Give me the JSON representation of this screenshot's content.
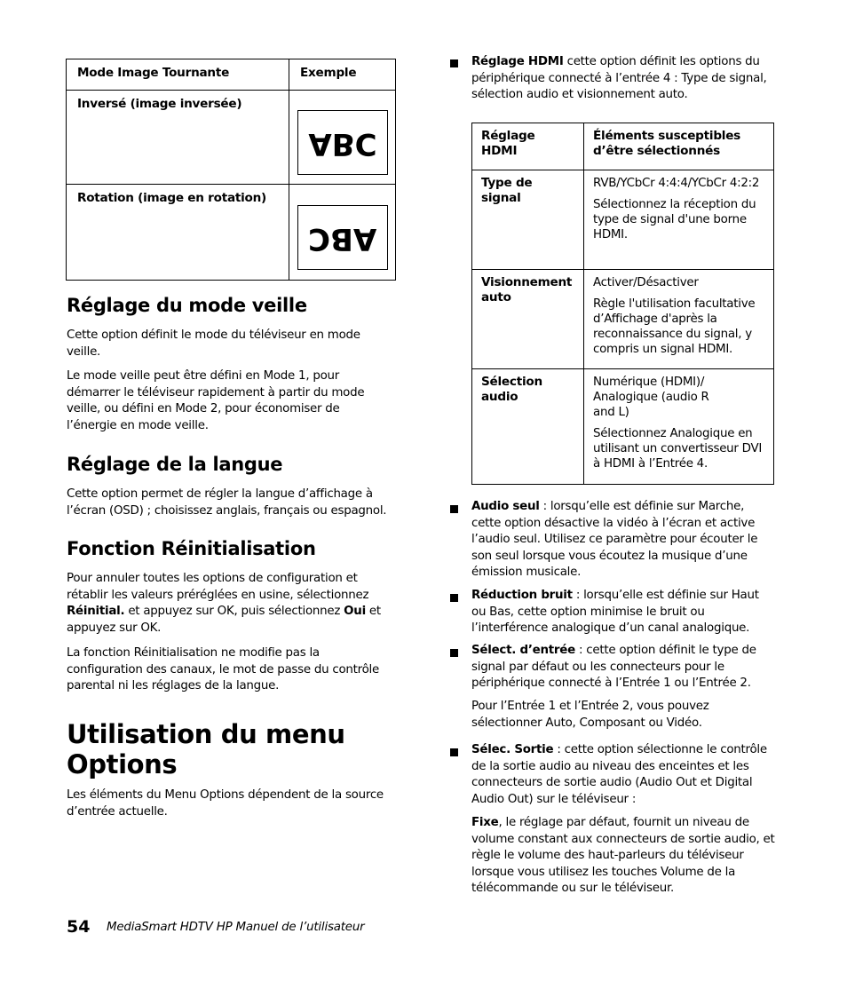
{
  "rotate_table": {
    "headers": [
      "Mode Image Tournante",
      "Exemple"
    ],
    "rows": [
      {
        "label": "Inversé (image inversée)",
        "example": "ABC",
        "example_transform": "vertical-flip"
      },
      {
        "label": "Rotation (image en rotation)",
        "example": "ABC",
        "example_transform": "rotate-180"
      }
    ]
  },
  "sections": {
    "veille": {
      "title": "Réglage du mode veille",
      "paragraphs": [
        "Cette option définit le mode du téléviseur en mode veille.",
        "Le mode veille peut être défini en Mode 1, pour démarrer le téléviseur rapidement à partir du mode veille, ou défini en Mode 2, pour économiser de l’énergie en mode veille."
      ]
    },
    "langue": {
      "title": "Réglage de la langue",
      "paragraphs": [
        "Cette option permet de régler la langue d’affichage à l’écran (OSD) ; choisissez anglais, français ou espagnol."
      ]
    },
    "reinit": {
      "title": "Fonction Réinitialisation",
      "p1_a": "Pour annuler toutes les options de configuration et rétablir les valeurs préréglées en usine, sélectionnez ",
      "p1_bold1": "Réinitial.",
      "p1_b": " et appuyez sur OK, puis sélectionnez ",
      "p1_bold2": "Oui",
      "p1_c": " et appuyez sur OK.",
      "p2": "La fonction Réinitialisation ne modifie pas la configuration des canaux, le mot de passe du contrôle parental ni les réglages de la langue."
    },
    "options": {
      "title": "Utilisation du menu Options",
      "paragraph": "Les éléments du Menu Options dépendent de la source d’entrée actuelle."
    }
  },
  "right": {
    "hdmi_bullet": {
      "bold": "Réglage HDMI",
      "text": " cette option définit les options du périphérique connecté à l’entrée 4 : Type de signal, sélection audio et visionnement auto."
    },
    "hdmi_table": {
      "headers": [
        "Réglage HDMI",
        "Éléments susceptibles d’être sélectionnés"
      ],
      "rows": [
        {
          "label": "Type de signal",
          "values": [
            "RVB/YCbCr 4:4:4/YCbCr 4:2:2",
            "Sélectionnez la réception du type de signal d'une borne HDMI."
          ]
        },
        {
          "label": "Visionnement auto",
          "values": [
            "Activer/Désactiver",
            "Règle l'utilisation facultative d’Affichage d'après la reconnaissance du signal, y compris un signal HDMI."
          ]
        },
        {
          "label": "Sélection audio",
          "values": [
            "Numérique (HDMI)/ Analogique (audio R and L)",
            "Sélectionnez Analogique en utilisant un convertisseur DVI à HDMI à l’Entrée 4."
          ]
        }
      ]
    },
    "bullets": [
      {
        "bold": "Audio seul",
        "text": " : lorsqu’elle est définie sur Marche, cette option désactive la vidéo à l’écran et active l’audio seul. Utilisez ce paramètre pour écouter le son seul lorsque vous écoutez la musique d’une émission musicale."
      },
      {
        "bold": "Réduction bruit",
        "text": " : lorsqu’elle est définie sur Haut ou Bas, cette option minimise le bruit ou l’interférence analogique d’un canal analogique."
      },
      {
        "bold": "Sélect. d’entrée",
        "text": " : cette option définit le type de signal par défaut ou les connecteurs pour le périphérique connecté à l’Entrée 1 ou l’Entrée 2.",
        "sub": "Pour l’Entrée 1 et l’Entrée 2, vous pouvez sélectionner Auto, Composant ou Vidéo."
      },
      {
        "bold": "Sélec. Sortie",
        "text": " : cette option sélectionne le contrôle de la sortie audio au niveau des enceintes et les connecteurs de sortie audio (Audio Out et Digital Audio Out) sur le téléviseur :",
        "sub_bold": "Fixe",
        "sub": ", le réglage par défaut, fournit un niveau de volume constant aux connecteurs de sortie audio, et règle le volume des haut-parleurs du téléviseur lorsque vous utilisez les touches Volume de la télécommande ou sur le téléviseur."
      }
    ]
  },
  "footer": {
    "page_number": "54",
    "title": "MediaSmart HDTV HP Manuel de l’utilisateur"
  }
}
